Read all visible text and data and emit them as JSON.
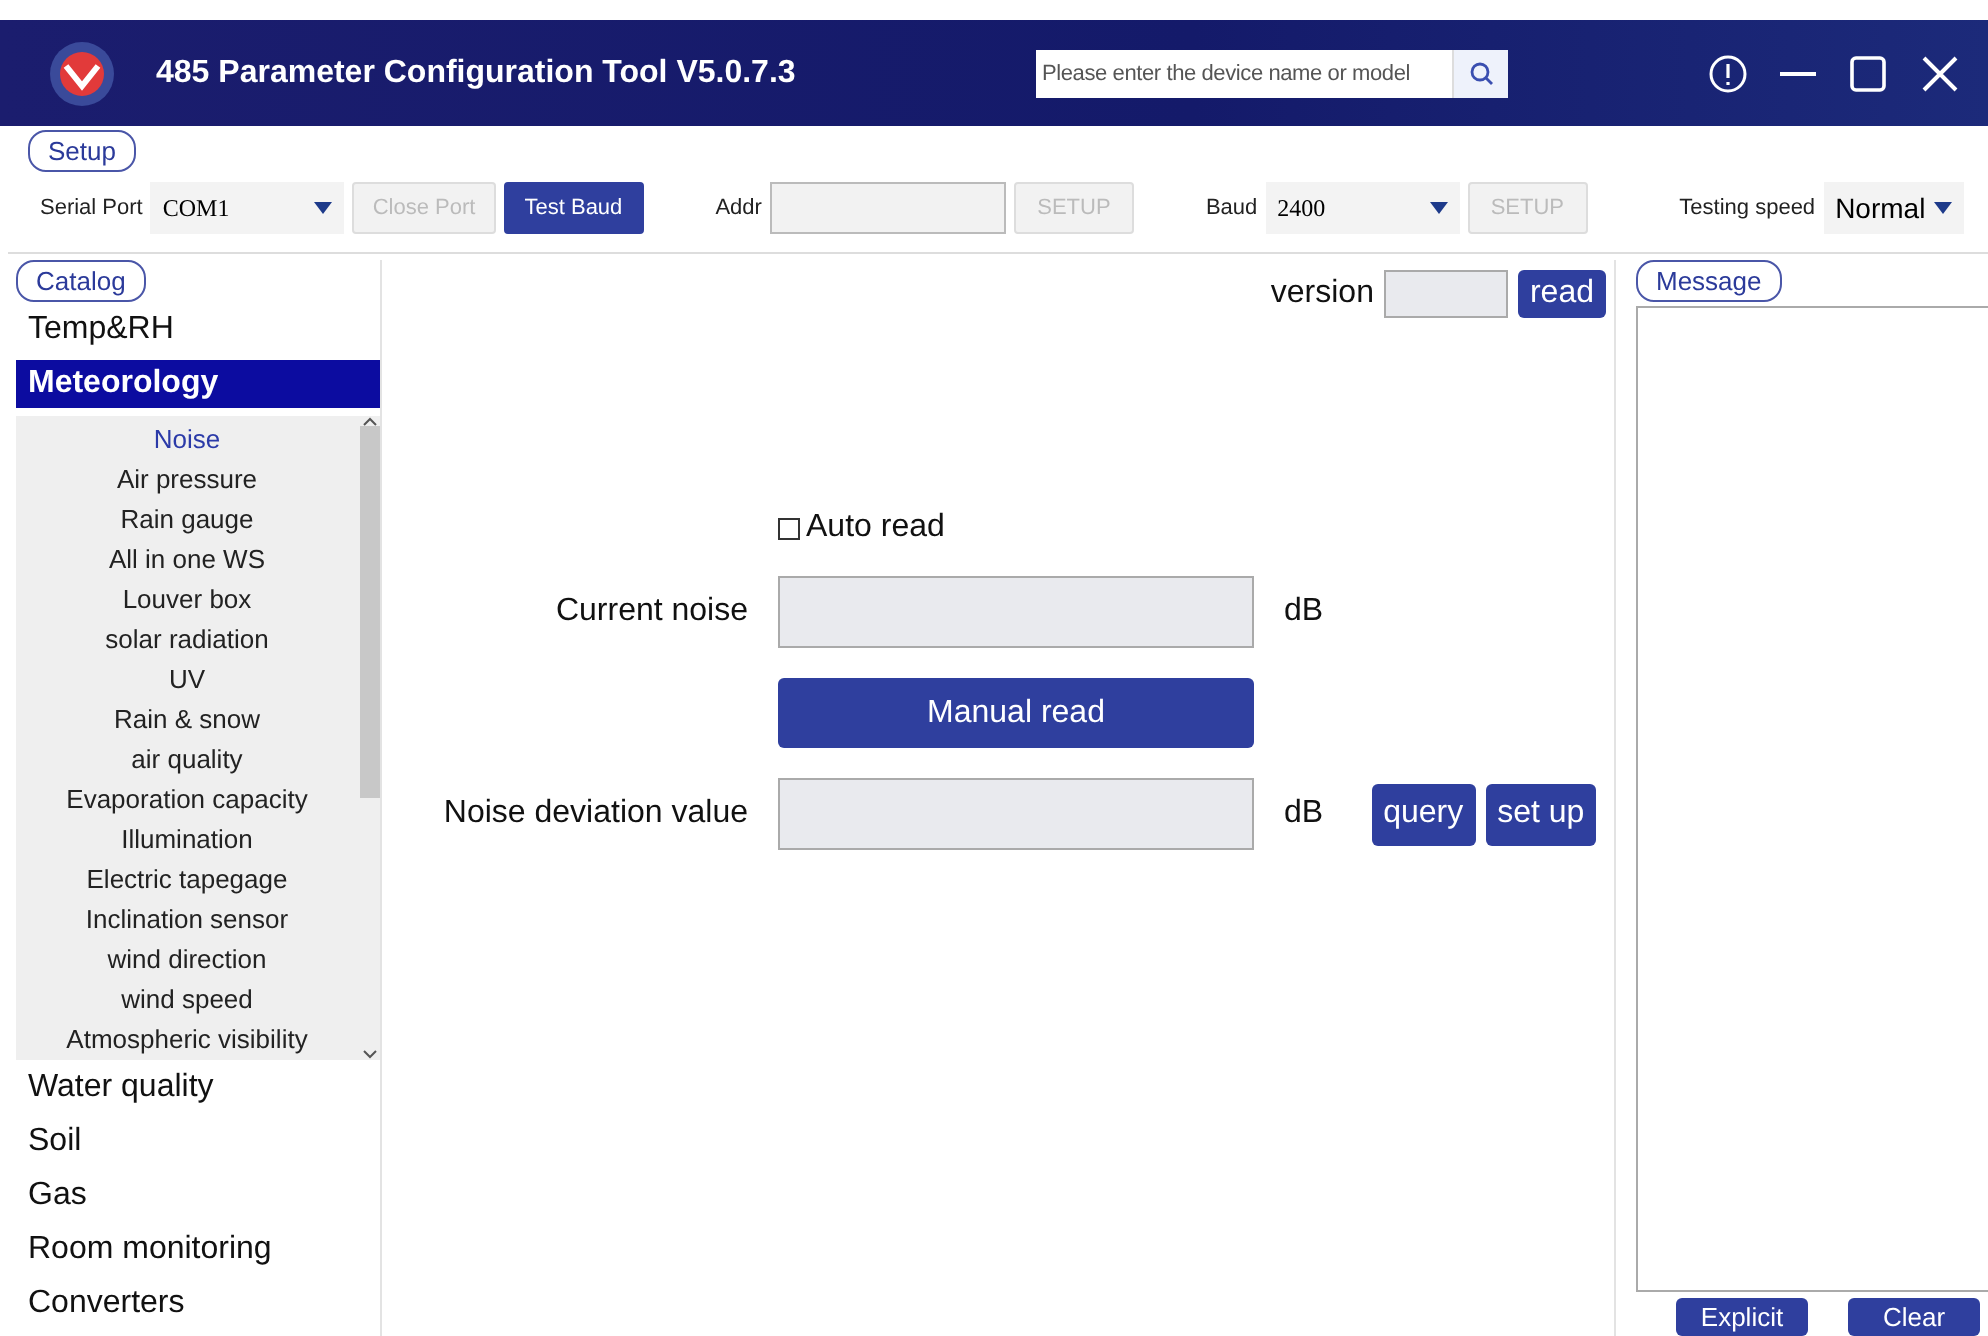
{
  "window": {
    "title": "485 Parameter Configuration Tool V5.0.7.3"
  },
  "search": {
    "placeholder": "Please enter the device name or model"
  },
  "setup": {
    "label": "Setup",
    "controls": [
      {
        "kind": "label",
        "text": "Serial Port"
      },
      {
        "kind": "select",
        "value": "COM1"
      },
      {
        "kind": "button",
        "text": "Close Port",
        "disabled": true
      },
      {
        "kind": "button",
        "text": "Test Baud",
        "disabled": false
      },
      {
        "kind": "label",
        "text": "Addr"
      },
      {
        "kind": "input"
      },
      {
        "kind": "button",
        "text": "SETUP",
        "disabled": true
      },
      {
        "kind": "label",
        "text": "Baud"
      },
      {
        "kind": "select",
        "value": "2400"
      },
      {
        "kind": "button",
        "text": "SETUP",
        "disabled": true
      },
      {
        "kind": "label",
        "text": "Testing speed"
      },
      {
        "kind": "select",
        "value": "Normal"
      }
    ]
  },
  "catalog": {
    "label": "Catalog",
    "categories": [
      {
        "label": "Temp&RH",
        "selected": false
      },
      {
        "label": "Meteorology",
        "selected": true,
        "expanded": true,
        "children": [
          {
            "label": "Noise",
            "selected": true
          },
          {
            "label": "Air pressure",
            "selected": false
          },
          {
            "label": "Rain gauge",
            "selected": false
          },
          {
            "label": "All in one WS",
            "selected": false
          },
          {
            "label": "Louver box",
            "selected": false
          },
          {
            "label": "solar radiation",
            "selected": false
          },
          {
            "label": "UV",
            "selected": false
          },
          {
            "label": "Rain & snow",
            "selected": false
          },
          {
            "label": "air quality",
            "selected": false
          },
          {
            "label": "Evaporation capacity",
            "selected": false
          },
          {
            "label": "Illumination",
            "selected": false
          },
          {
            "label": "Electric tapegage",
            "selected": false
          },
          {
            "label": "Inclination sensor",
            "selected": false
          },
          {
            "label": "wind direction",
            "selected": false
          },
          {
            "label": "wind speed",
            "selected": false
          },
          {
            "label": "Atmospheric visibility",
            "selected": false
          }
        ]
      },
      {
        "label": "Water quality",
        "selected": false
      },
      {
        "label": "Soil",
        "selected": false
      },
      {
        "label": "Gas",
        "selected": false
      },
      {
        "label": "Room monitoring",
        "selected": false
      },
      {
        "label": "Converters",
        "selected": false
      }
    ]
  },
  "version": {
    "label": "version",
    "button": "read"
  },
  "auto_read": {
    "label": "Auto read",
    "checked": false
  },
  "current_noise": {
    "label": "Current noise",
    "unit": "dB"
  },
  "manual_read": {
    "label": "Manual read"
  },
  "noise_deviation": {
    "label": "Noise deviation value",
    "unit": "dB",
    "buttons": [
      "query",
      "set up"
    ]
  },
  "message": {
    "label": "Message",
    "buttons": [
      "Explicit",
      "Clear"
    ]
  }
}
